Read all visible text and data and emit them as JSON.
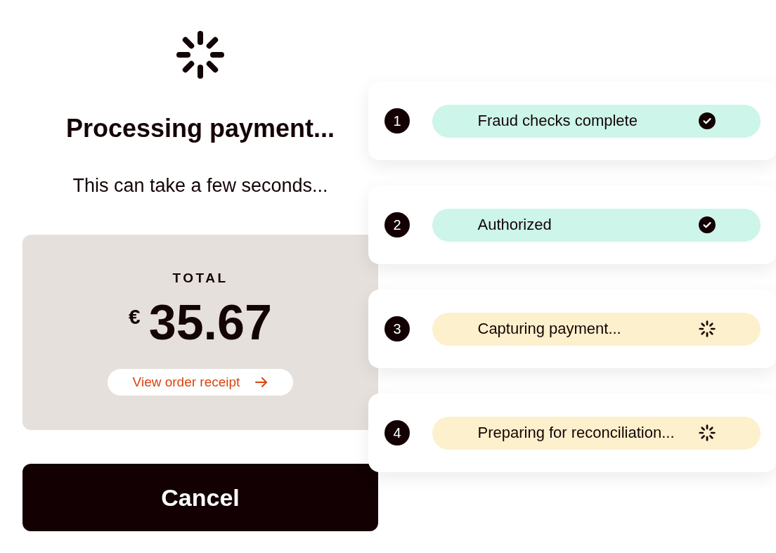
{
  "heading": {
    "title": "Processing payment...",
    "subtitle": "This can take a few seconds..."
  },
  "total": {
    "label": "TOTAL",
    "currency": "€",
    "amount": "35.67",
    "receipt_link": "View order receipt"
  },
  "cancel_button": "Cancel",
  "steps": [
    {
      "number": "1",
      "label": "Fraud checks complete",
      "done": true
    },
    {
      "number": "2",
      "label": "Authorized",
      "done": true
    },
    {
      "number": "3",
      "label": "Capturing payment...",
      "done": false
    },
    {
      "number": "4",
      "label": "Preparing for reconciliation...",
      "done": false
    }
  ]
}
